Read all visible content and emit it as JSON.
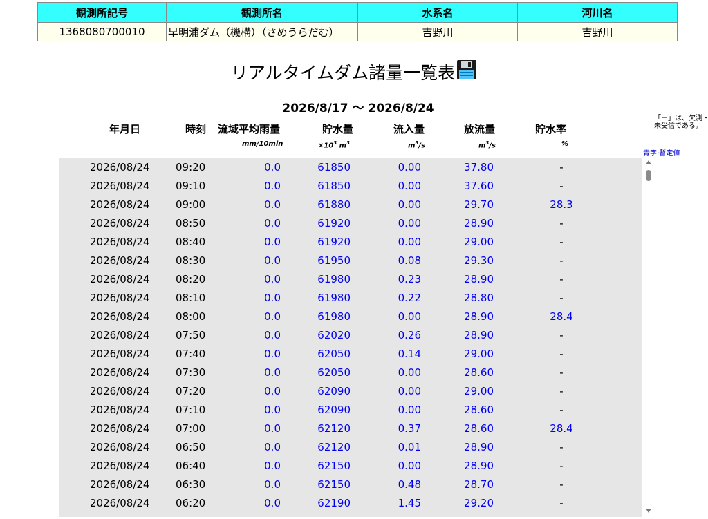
{
  "station": {
    "headers": [
      "観測所記号",
      "観測所名",
      "水系名",
      "河川名"
    ],
    "code": "1368080700010",
    "name": "早明浦ダム（機構）（さめうらだむ）",
    "system": "吉野川",
    "river": "吉野川"
  },
  "page_title": "リアルタイムダム諸量一覧表",
  "save_icon": "floppy-disk-icon",
  "period": "2026/8/17 ～ 2026/8/24",
  "columns": {
    "date": "年月日",
    "time": "時刻",
    "rain": "流域平均雨量",
    "rain_unit": "mm/10min",
    "storage": "貯水量",
    "storage_unit_pre": "×10",
    "storage_unit_exp": "3",
    "storage_unit_post": "m",
    "storage_unit_exp2": "3",
    "inflow": "流入量",
    "inflow_unit": "m",
    "inflow_unit_exp": "3",
    "inflow_unit_post": "/s",
    "outflow": "放流量",
    "outflow_unit": "m",
    "outflow_unit_exp": "3",
    "outflow_unit_post": "/s",
    "rate": "貯水率",
    "rate_unit": "%"
  },
  "notes": {
    "missing": "「－」は、欠測・未受信である。",
    "blue": "青字:暫定値"
  },
  "rows": [
    {
      "date": "2026/08/24",
      "time": "09:20",
      "rain": "0.0",
      "storage": "61850",
      "inflow": "0.00",
      "outflow": "37.80",
      "rate": "-"
    },
    {
      "date": "2026/08/24",
      "time": "09:10",
      "rain": "0.0",
      "storage": "61850",
      "inflow": "0.00",
      "outflow": "37.60",
      "rate": "-"
    },
    {
      "date": "2026/08/24",
      "time": "09:00",
      "rain": "0.0",
      "storage": "61880",
      "inflow": "0.00",
      "outflow": "29.70",
      "rate": "28.3"
    },
    {
      "date": "2026/08/24",
      "time": "08:50",
      "rain": "0.0",
      "storage": "61920",
      "inflow": "0.00",
      "outflow": "28.90",
      "rate": "-"
    },
    {
      "date": "2026/08/24",
      "time": "08:40",
      "rain": "0.0",
      "storage": "61920",
      "inflow": "0.00",
      "outflow": "29.00",
      "rate": "-"
    },
    {
      "date": "2026/08/24",
      "time": "08:30",
      "rain": "0.0",
      "storage": "61950",
      "inflow": "0.08",
      "outflow": "29.30",
      "rate": "-"
    },
    {
      "date": "2026/08/24",
      "time": "08:20",
      "rain": "0.0",
      "storage": "61980",
      "inflow": "0.23",
      "outflow": "28.90",
      "rate": "-"
    },
    {
      "date": "2026/08/24",
      "time": "08:10",
      "rain": "0.0",
      "storage": "61980",
      "inflow": "0.22",
      "outflow": "28.80",
      "rate": "-"
    },
    {
      "date": "2026/08/24",
      "time": "08:00",
      "rain": "0.0",
      "storage": "61980",
      "inflow": "0.00",
      "outflow": "28.90",
      "rate": "28.4"
    },
    {
      "date": "2026/08/24",
      "time": "07:50",
      "rain": "0.0",
      "storage": "62020",
      "inflow": "0.26",
      "outflow": "28.90",
      "rate": "-"
    },
    {
      "date": "2026/08/24",
      "time": "07:40",
      "rain": "0.0",
      "storage": "62050",
      "inflow": "0.14",
      "outflow": "29.00",
      "rate": "-"
    },
    {
      "date": "2026/08/24",
      "time": "07:30",
      "rain": "0.0",
      "storage": "62050",
      "inflow": "0.00",
      "outflow": "28.60",
      "rate": "-"
    },
    {
      "date": "2026/08/24",
      "time": "07:20",
      "rain": "0.0",
      "storage": "62090",
      "inflow": "0.00",
      "outflow": "29.00",
      "rate": "-"
    },
    {
      "date": "2026/08/24",
      "time": "07:10",
      "rain": "0.0",
      "storage": "62090",
      "inflow": "0.00",
      "outflow": "28.60",
      "rate": "-"
    },
    {
      "date": "2026/08/24",
      "time": "07:00",
      "rain": "0.0",
      "storage": "62120",
      "inflow": "0.37",
      "outflow": "28.60",
      "rate": "28.4"
    },
    {
      "date": "2026/08/24",
      "time": "06:50",
      "rain": "0.0",
      "storage": "62120",
      "inflow": "0.01",
      "outflow": "28.90",
      "rate": "-"
    },
    {
      "date": "2026/08/24",
      "time": "06:40",
      "rain": "0.0",
      "storage": "62150",
      "inflow": "0.00",
      "outflow": "28.90",
      "rate": "-"
    },
    {
      "date": "2026/08/24",
      "time": "06:30",
      "rain": "0.0",
      "storage": "62150",
      "inflow": "0.48",
      "outflow": "28.70",
      "rate": "-"
    },
    {
      "date": "2026/08/24",
      "time": "06:20",
      "rain": "0.0",
      "storage": "62190",
      "inflow": "1.45",
      "outflow": "29.20",
      "rate": "-"
    }
  ]
}
